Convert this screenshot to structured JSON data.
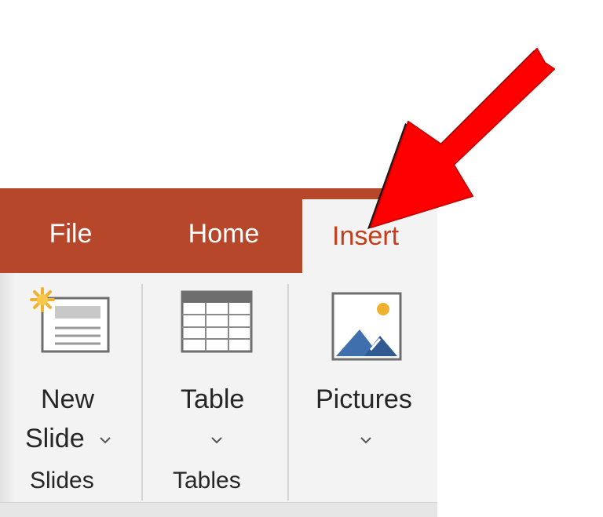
{
  "tabs": [
    {
      "id": "file",
      "label": "File"
    },
    {
      "id": "home",
      "label": "Home"
    },
    {
      "id": "insert",
      "label": "Insert",
      "active": true
    }
  ],
  "ribbon": {
    "groups": {
      "slides": {
        "label": "Slides",
        "new_slide": {
          "line1": "New",
          "line2": "Slide"
        }
      },
      "tables": {
        "label": "Tables",
        "table": {
          "label": "Table"
        }
      },
      "images": {
        "pictures": {
          "label": "Pictures"
        }
      }
    }
  },
  "colors": {
    "tab_bar": "#b7472a",
    "active_tab_text": "#c43e1c",
    "ribbon_bg": "#f3f3f3",
    "annotation_arrow": "#ff0000"
  },
  "annotation": {
    "icon": "red-arrow-icon",
    "points_to": "insert"
  }
}
